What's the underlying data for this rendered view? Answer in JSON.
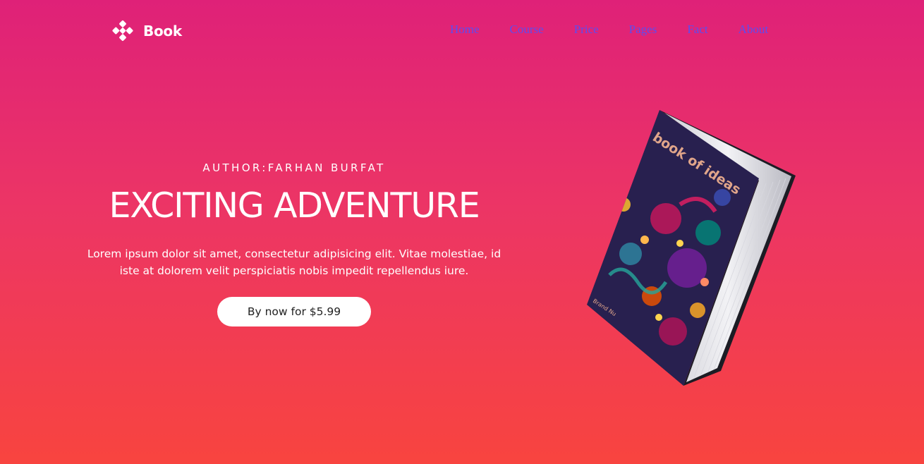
{
  "navbar": {
    "brand": "Book",
    "brand_icon": "diamond-cluster-icon",
    "links": [
      "Home",
      "Course",
      "Price",
      "Pages",
      "Fact",
      "About"
    ],
    "link_color": "#5d4cf0"
  },
  "hero": {
    "author": "AUTHOR:FARHAN BURFAT",
    "title": "EXCITING ADVENTURE",
    "description": "Lorem ipsum dolor sit amet, consectetur adipisicing elit. Vitae molestiae, id iste at dolorem velit perspiciatis nobis impedit repellendus iure.",
    "cta_label": "By now for $5.99"
  },
  "book": {
    "cover_title": "book of ideas",
    "cover_author": "Brand Nu",
    "cover_color": "#28204f"
  },
  "colors": {
    "gradient_top": "#df2178",
    "gradient_mid": "#ec3565",
    "gradient_bottom": "#f8443f"
  }
}
